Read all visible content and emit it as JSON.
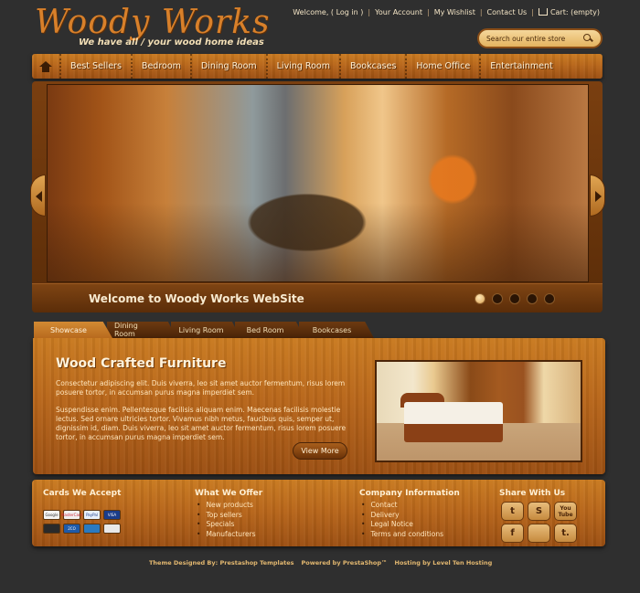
{
  "header": {
    "logo_title": "Woody Works",
    "logo_tagline": "We have all / your wood home ideas",
    "toplinks": {
      "welcome": "Welcome, ( Log in )",
      "account": "Your Account",
      "wishlist": "My Wishlist",
      "contact": "Contact Us",
      "cart": "Cart: (empty)"
    },
    "search_placeholder": "Search our entire store"
  },
  "nav": {
    "items": [
      "Best Sellers",
      "Bedroom",
      "Dining Room",
      "Living Room",
      "Bookcases",
      "Home Office",
      "Entertainment"
    ]
  },
  "slider": {
    "caption": "Welcome to Woody Works WebSite",
    "dot_count": 5,
    "active_dot": 1
  },
  "tabs": [
    "Showcase",
    "Dining Room",
    "Living Room",
    "Bed Room",
    "Bookcases"
  ],
  "showcase": {
    "title": "Wood Crafted Furniture",
    "para1": "Consectetur adipiscing elit. Duis viverra, leo sit amet auctor fermentum, risus lorem posuere tortor, in accumsan purus magna imperdiet sem.",
    "para2": "Suspendisse enim. Pellentesque facilisis aliquam enim. Maecenas facilisis molestie lectus. Sed ornare ultricies tortor. Vivamus nibh metus, faucibus quis, semper ut, dignissim id, diam. Duis viverra, leo sit amet auctor fermentum, risus lorem posuere tortor, in accumsan purus magna imperdiet sem.",
    "button": "View More"
  },
  "footer": {
    "cards_title": "Cards We Accept",
    "cards": [
      "Google",
      "MasterCard",
      "PayPal",
      "VISA",
      "",
      "2CO",
      "",
      ""
    ],
    "offer_title": "What We Offer",
    "offer_items": [
      "New products",
      "Top sellers",
      "Specials",
      "Manufacturers"
    ],
    "company_title": "Company Information",
    "company_items": [
      "Contact",
      "Delivery",
      "Legal Notice",
      "Terms and conditions"
    ],
    "share_title": "Share With Us",
    "social": [
      "t",
      "S",
      "You Tube",
      "f",
      "",
      "t."
    ]
  },
  "credits": {
    "designed": "Theme Designed By: Prestashop Templates",
    "powered": "Powered by PrestaShop™",
    "hosting": "Hosting by Level Ten Hosting"
  },
  "colors": {
    "background": "#2f2f2f",
    "wood_light": "#c97a20",
    "wood_dark": "#9b4f12",
    "accent_text": "#e3b870"
  }
}
